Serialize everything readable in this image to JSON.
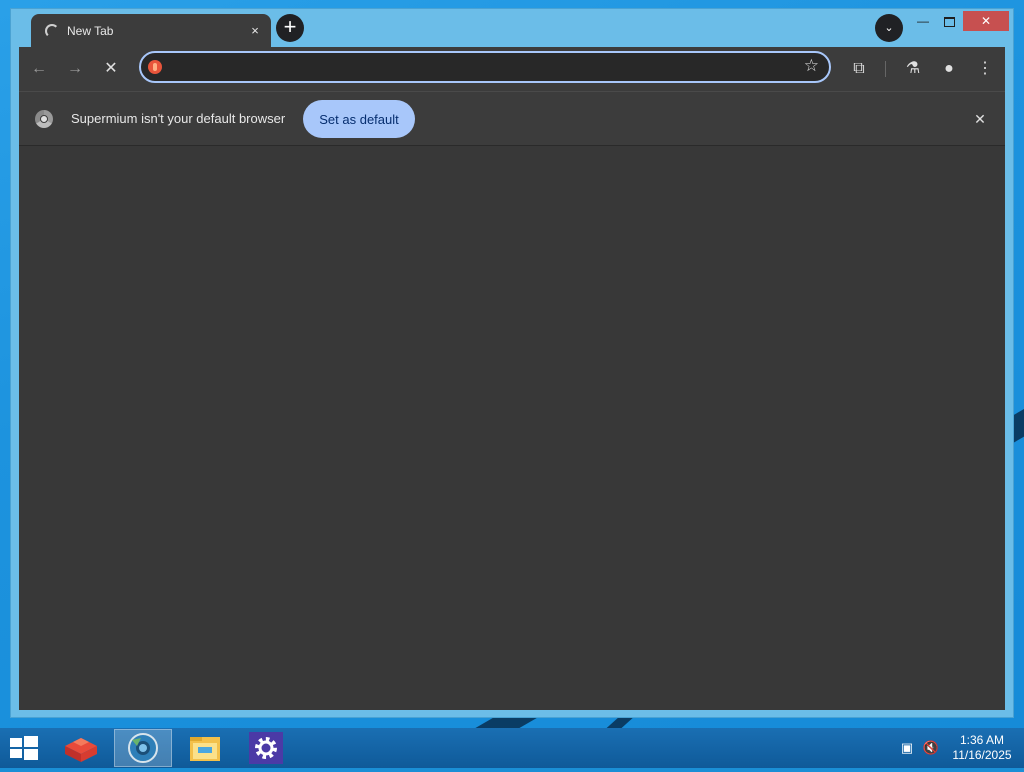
{
  "browser": {
    "tab": {
      "title": "New Tab",
      "close_icon": "×"
    },
    "new_tab_icon": "+",
    "tab_search_icon": "⌄",
    "window_controls": {
      "minimize": "—",
      "close": "✕"
    },
    "toolbar": {
      "back_icon": "←",
      "forward_icon": "→",
      "stop_icon": "✕",
      "omnibox": {
        "value": "",
        "placeholder": ""
      },
      "star_icon": "☆",
      "extensions_icon": "⧉",
      "labs_icon": "⚗",
      "profile_icon": "●",
      "menu_icon": "⋮"
    },
    "infobar": {
      "message": "Supermium isn't your default browser",
      "button": "Set as default",
      "close_icon": "✕"
    }
  },
  "taskbar": {
    "clock": {
      "time": "1:36 AM",
      "date": "11/16/2025"
    }
  },
  "colors": {
    "accent": "#a8c7fa",
    "window_frame": "#6bbde8",
    "toolbar": "#3c3c3c",
    "content": "#383838",
    "taskbar": "#1565a8"
  }
}
